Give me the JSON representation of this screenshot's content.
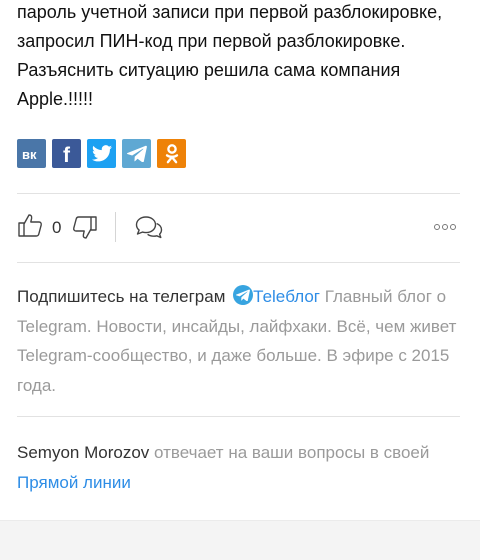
{
  "article": {
    "lines": [
      "пароль учетной записи при первой разблокировке,",
      "запросил ПИН-код при первой разблокировке.",
      "Разъяснить ситуацию решила сама компания",
      "Apple.!!!!!"
    ]
  },
  "share": {
    "buttons": [
      {
        "name": "vk",
        "label": "вк",
        "color": "#4a76a8",
        "icon": "vk-icon"
      },
      {
        "name": "facebook",
        "label": "f",
        "color": "#3b5998",
        "icon": "facebook-icon"
      },
      {
        "name": "twitter",
        "label": "",
        "color": "#1da1f2",
        "icon": "twitter-icon"
      },
      {
        "name": "telegram",
        "label": "",
        "color": "#5fa8d3",
        "icon": "telegram-icon"
      },
      {
        "name": "odnoklassniki",
        "label": "",
        "color": "#ee8208",
        "icon": "odnoklassniki-icon"
      }
    ]
  },
  "reactions": {
    "like_count": "0"
  },
  "promo": {
    "prefix": "Подпишитесь на телеграм ",
    "channel": "Теleблог",
    "description": " Главный блог о Telegram. Новости, инсайды, лайфхаки. Всё, чем живет Telegram-сообщество, и даже больше. В эфире с 2015 года."
  },
  "qa": {
    "author": "Semyon Morozov",
    "text": " отвечает на ваши вопросы в своей ",
    "link": "Прямой линии"
  },
  "colors": {
    "link": "#2e8de6",
    "muted": "#9a9a9a",
    "telegram_badge": "#37a4e0"
  }
}
